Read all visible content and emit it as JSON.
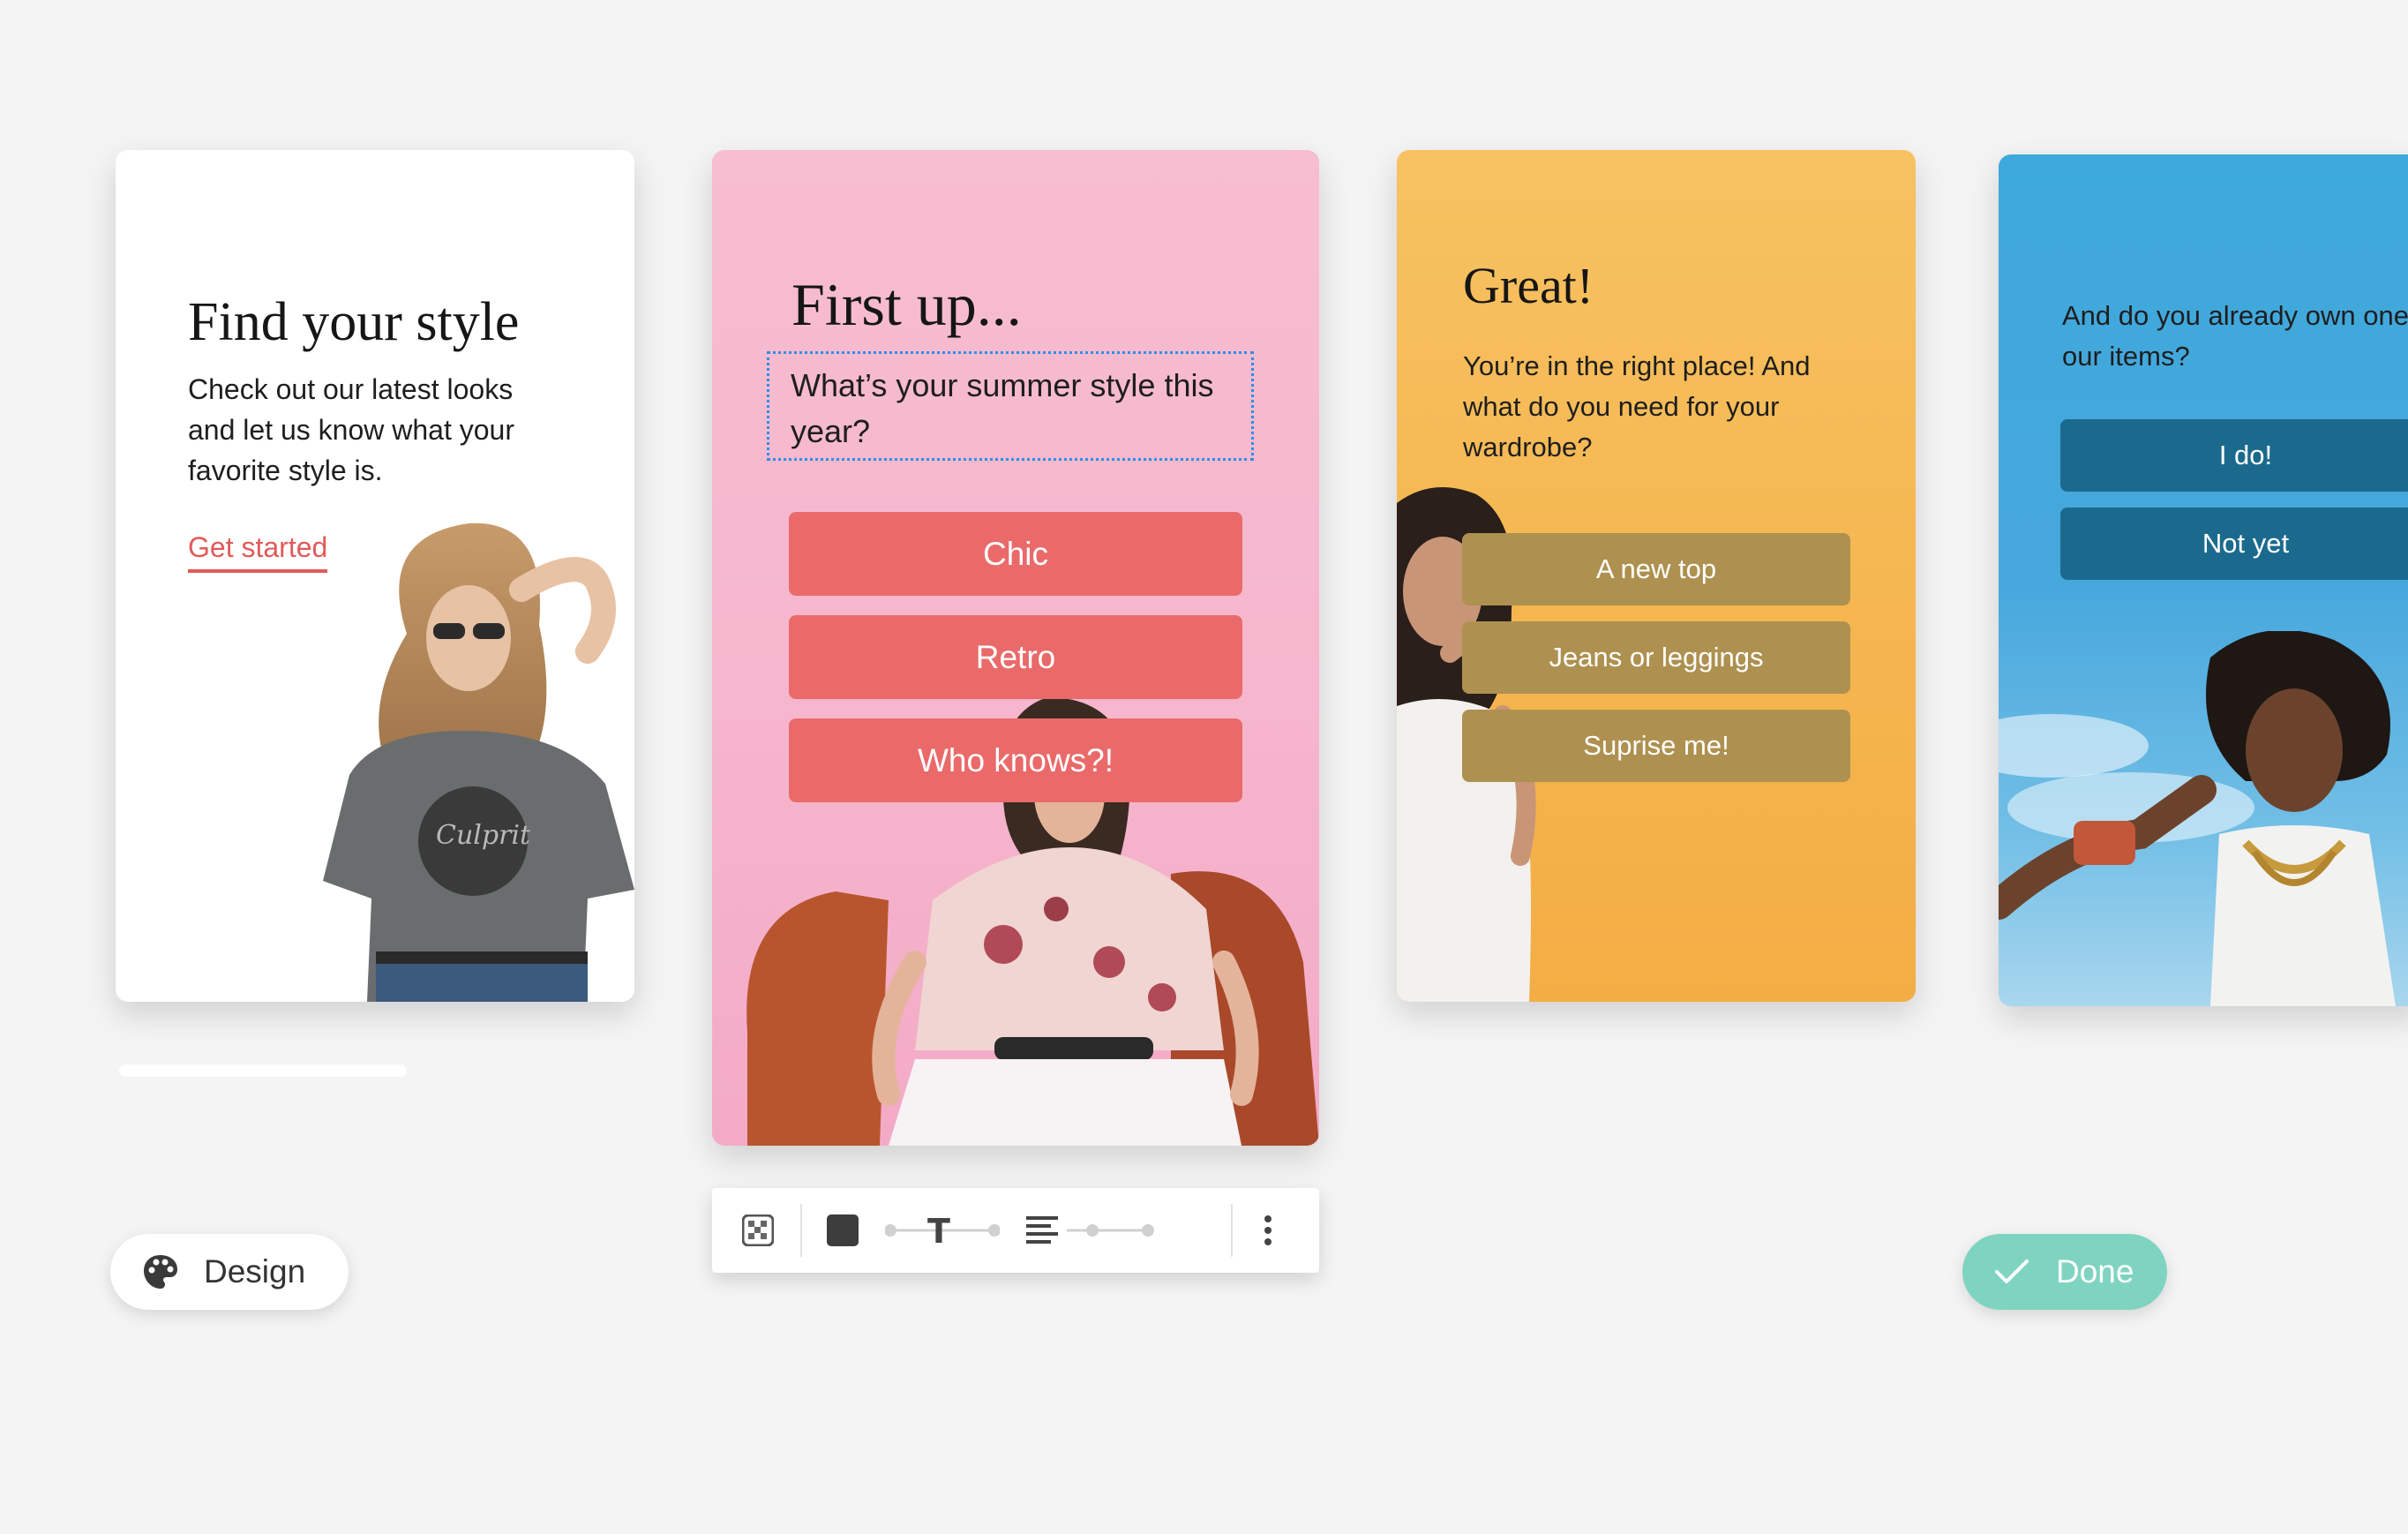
{
  "cards": {
    "find_style": {
      "title": "Find your style",
      "body": "Check out our latest looks and let us know what your favorite style is.",
      "link": "Get started"
    },
    "first_up": {
      "title": "First up...",
      "question": "What’s your summer style this year?",
      "options": [
        "Chic",
        "Retro",
        "Who knows?!"
      ]
    },
    "great": {
      "title": "Great!",
      "body": "You’re in the right place! And what do you need for your wardrobe?",
      "options": [
        "A new top",
        "Jeans or leggings",
        "Suprise me!"
      ]
    },
    "own_items": {
      "body": "And do you already own one of our items?",
      "options": [
        "I do!",
        "Not yet"
      ]
    }
  },
  "buttons": {
    "design": "Design",
    "done": "Done"
  },
  "icons": {
    "design": "palette-icon",
    "done": "check-icon",
    "toolbar": [
      "transparency-icon",
      "color-fill-icon",
      "text-size-icon",
      "text-align-icon",
      "more-vertical-icon"
    ]
  },
  "colors": {
    "pink_button": "#ea6a6a",
    "gold_button": "#ae9150",
    "blue_button": "#1b6a8e",
    "done": "#7fd4c1",
    "link": "#e15a5a"
  }
}
